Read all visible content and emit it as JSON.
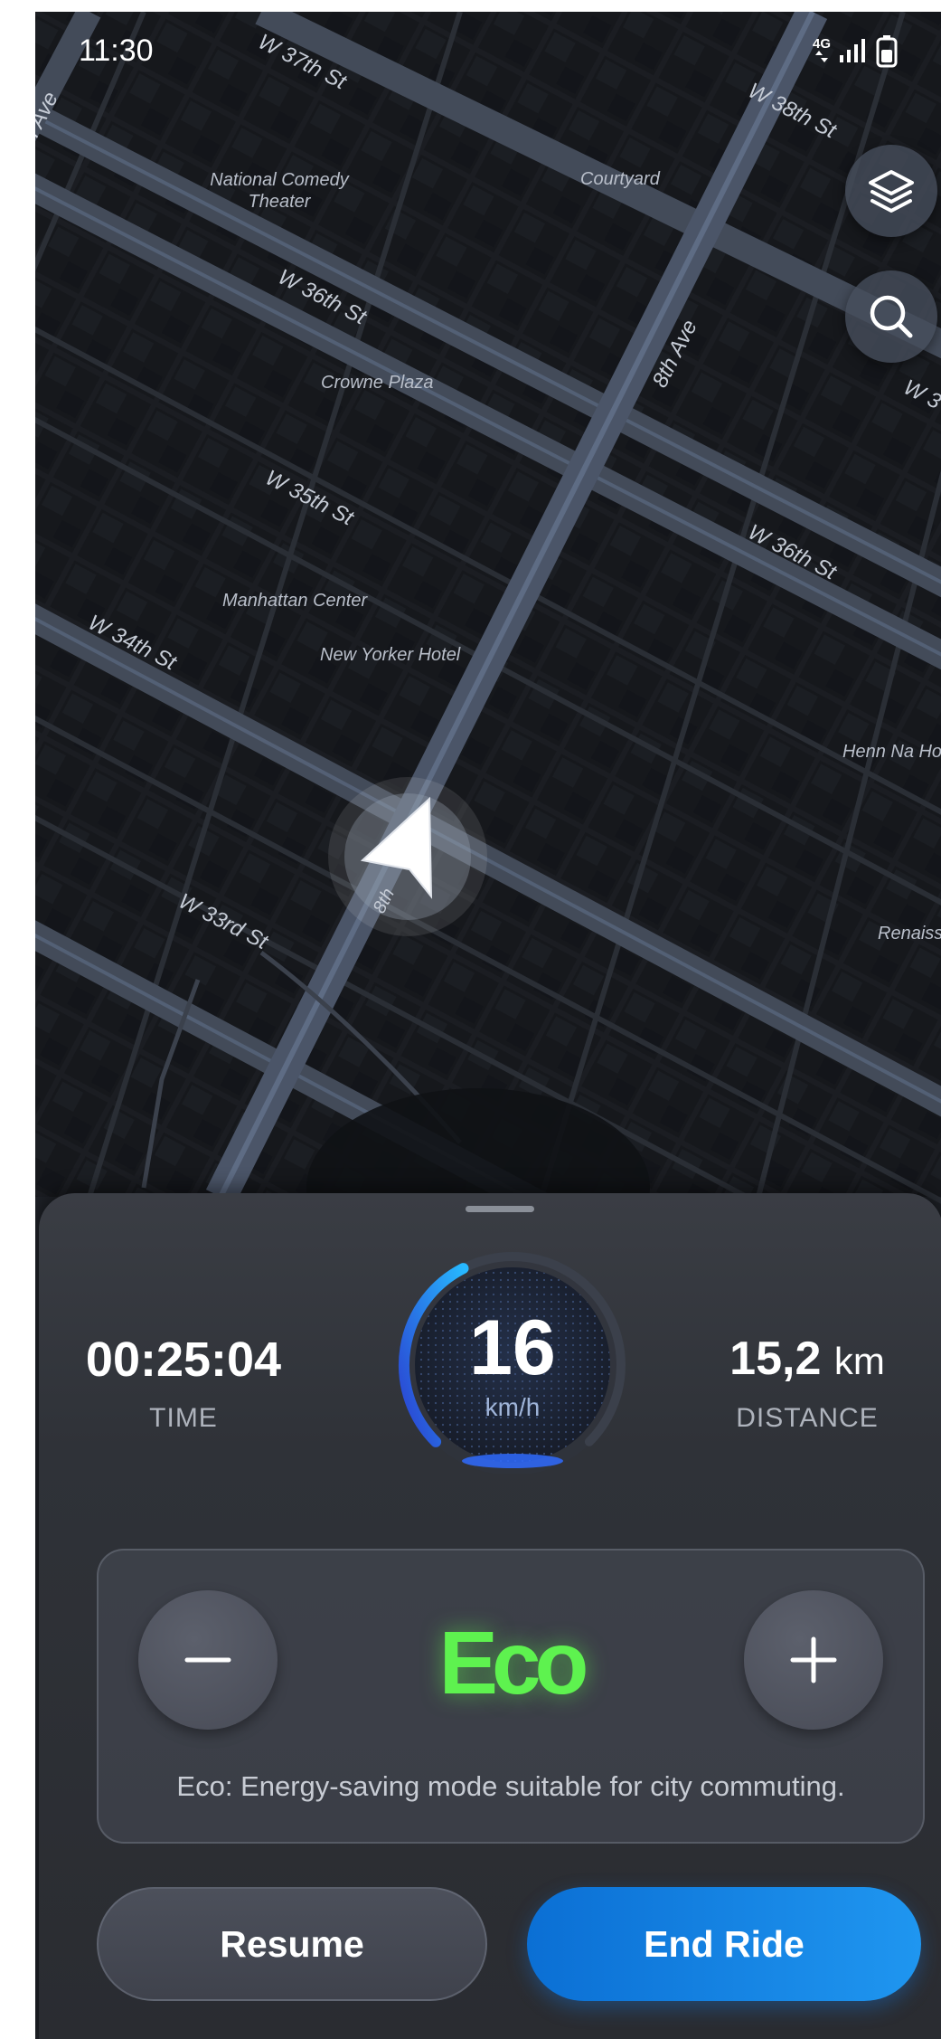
{
  "status_bar": {
    "time": "11:30",
    "network": "4G"
  },
  "map": {
    "theme_colors": {
      "background": "#1e2127",
      "blocks": "#17191d",
      "road": "#4c5565",
      "road_glow": "#637594"
    },
    "streets": {
      "w37": "W 37th St",
      "w38": "W 38th St",
      "w36_left": "W 36th St",
      "w36_right": "W 36th St",
      "w35": "W 35th St",
      "w34": "W 34th St",
      "w33": "W 33rd St",
      "ave8": "8th Ave",
      "ave8_short": "8th",
      "w_edge": "W 3",
      "ave_edge": "h Ave"
    },
    "places": {
      "comedy": "National Comedy Theater",
      "courtyard": "Courtyard",
      "crowne": "Crowne Plaza",
      "manhattan": "Manhattan Center",
      "new_yorker": "New Yorker Hotel",
      "henn": "Henn Na Ho",
      "renaiss": "Renaiss"
    },
    "buttons": {
      "layers_icon": "layers-icon",
      "search_icon": "search-icon"
    }
  },
  "ride": {
    "time": {
      "value": "00:25:04",
      "label": "TIME"
    },
    "speed": {
      "value": "16",
      "unit": "km/h",
      "progress": 0.4
    },
    "distance": {
      "value": "15,2",
      "unit": "km",
      "label": "DISTANCE"
    }
  },
  "mode": {
    "name": "Eco",
    "description": "Eco: Energy-saving mode suitable for city commuting.",
    "accent_color": "#5ef24f",
    "decrease_icon": "minus-icon",
    "increase_icon": "plus-icon"
  },
  "actions": {
    "resume_label": "Resume",
    "end_label": "End Ride",
    "end_color": "#1480e6"
  }
}
